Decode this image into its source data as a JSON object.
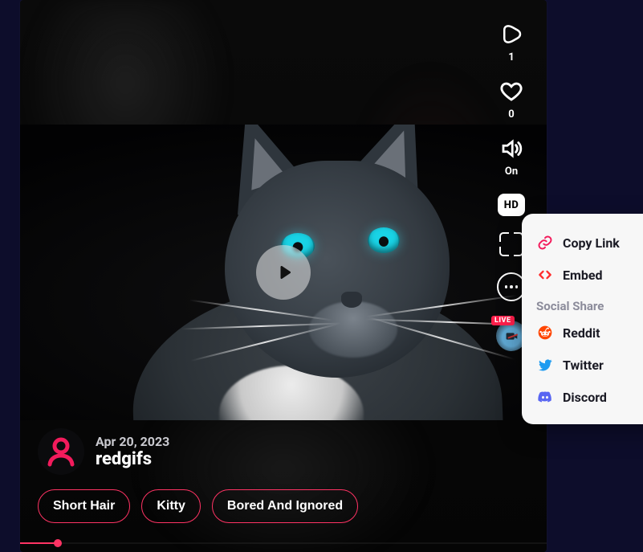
{
  "colors": {
    "accent": "#f31b5c",
    "twitter": "#1d9bf0",
    "discord": "#5865F2",
    "reddit": "#ff4500"
  },
  "rail": {
    "play_count": "1",
    "like_count": "0",
    "sound_label": "On",
    "quality_label": "HD",
    "live_label": "LIVE"
  },
  "author": {
    "date": "Apr 20, 2023",
    "username": "redgifs"
  },
  "tags": [
    "Short Hair",
    "Kitty",
    "Bored And Ignored"
  ],
  "share_menu": {
    "copy_link": "Copy Link",
    "embed": "Embed",
    "heading": "Social Share",
    "reddit": "Reddit",
    "twitter": "Twitter",
    "discord": "Discord"
  }
}
